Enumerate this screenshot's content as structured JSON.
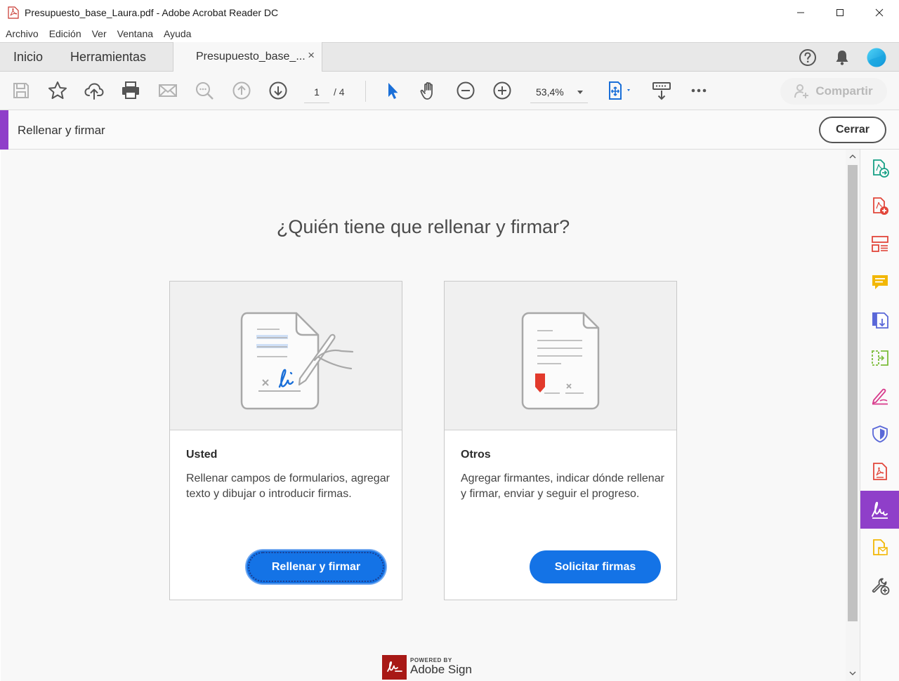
{
  "window": {
    "title": "Presupuesto_base_Laura.pdf - Adobe Acrobat Reader DC"
  },
  "menu": [
    "Archivo",
    "Edición",
    "Ver",
    "Ventana",
    "Ayuda"
  ],
  "tabs": {
    "home": "Inicio",
    "tools": "Herramientas",
    "document": "Presupuesto_base_...",
    "close": "×"
  },
  "toolbar": {
    "page_current": "1",
    "page_total": "/ 4",
    "zoom": "53,4%",
    "share_label": "Compartir"
  },
  "fill_sign": {
    "label": "Rellenar y firmar",
    "close_label": "Cerrar",
    "accent_color": "#8f3fc9"
  },
  "main": {
    "heading": "¿Quién tiene que rellenar y firmar?",
    "cards": [
      {
        "title": "Usted",
        "description": "Rellenar campos de formularios, agregar texto y dibujar o introducir firmas.",
        "button": "Rellenar y firmar",
        "icon": "sign-document-illustration"
      },
      {
        "title": "Otros",
        "description": "Agregar firmantes, indicar dónde rellenar y firmar, enviar y seguir el progreso.",
        "button": "Solicitar firmas",
        "icon": "request-signature-illustration"
      }
    ],
    "powered_by": "POWERED BY",
    "brand": "Adobe Sign"
  },
  "colors": {
    "primary_button": "#1473e6",
    "accent": "#8f3fc9"
  },
  "right_rail": [
    "export-pdf-icon",
    "create-pdf-icon",
    "organize-pages-icon",
    "comment-icon",
    "export-to-icon",
    "edit-pdf-icon",
    "fill-sign-pen-icon",
    "protect-icon",
    "pdf-icon",
    "fill-and-sign-icon",
    "send-for-review-icon",
    "more-tools-icon"
  ]
}
